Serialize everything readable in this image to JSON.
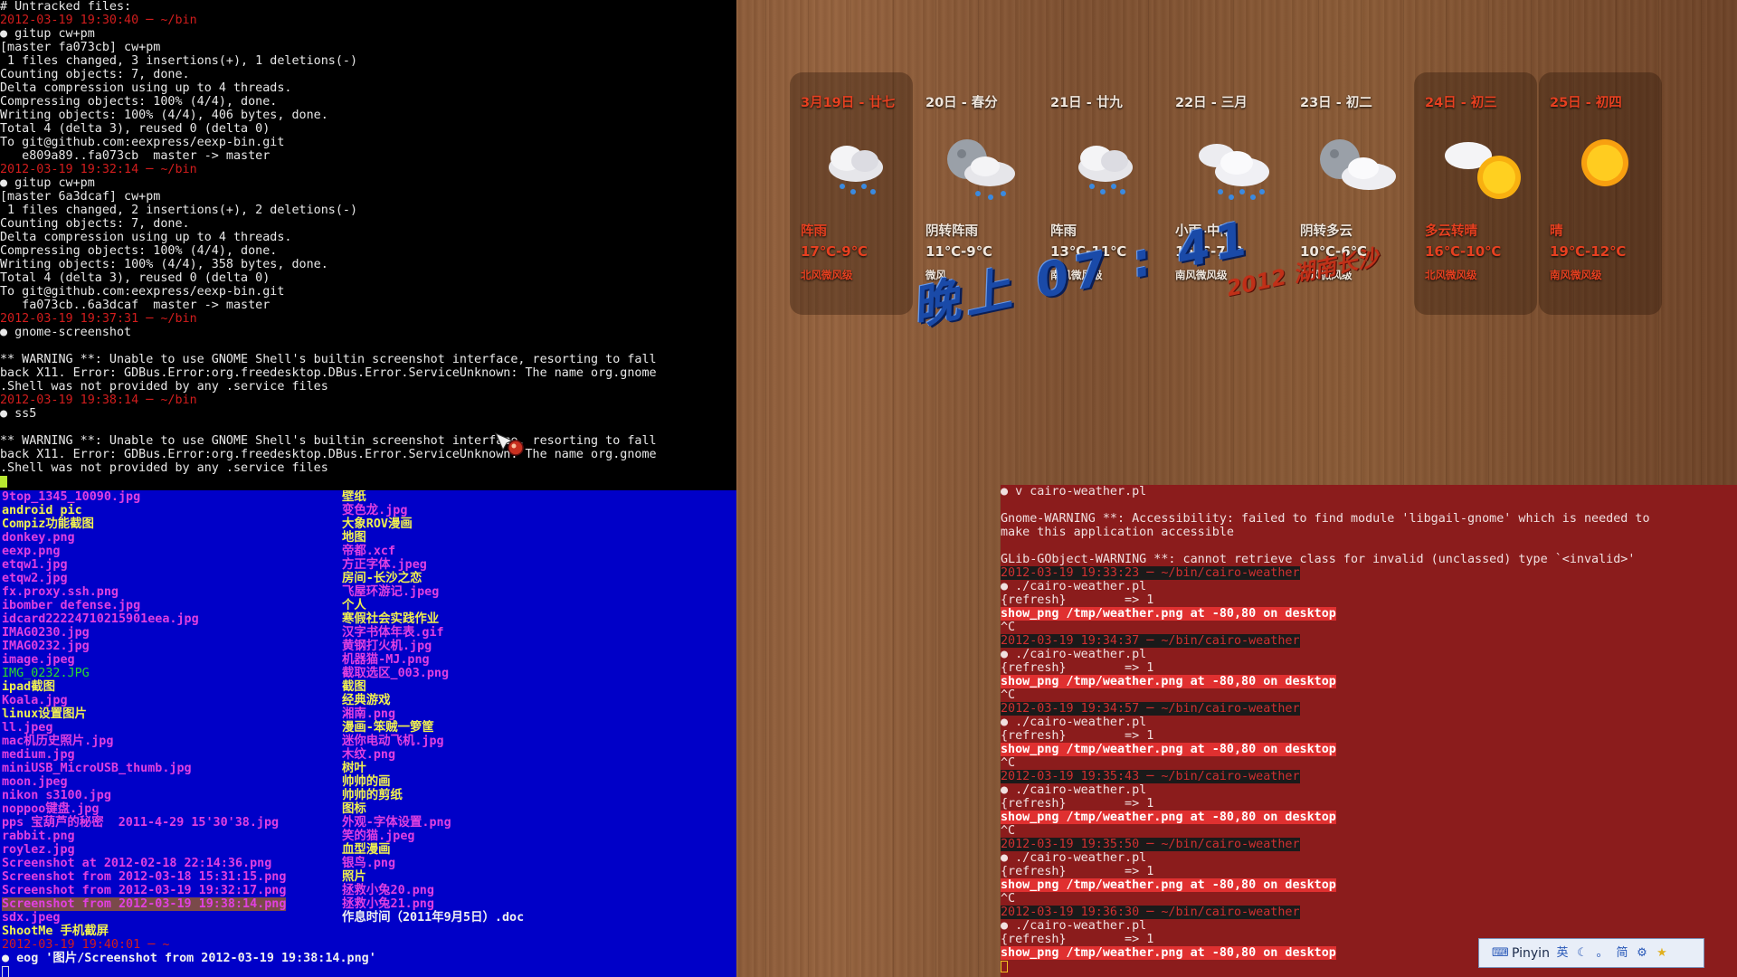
{
  "terminal_git": {
    "lines": [
      {
        "t": "# Untracked files:",
        "c": ""
      },
      {
        "t": "2012-03-19 19:30:40 ─ ~/bin",
        "c": "ts"
      },
      {
        "t": "● gitup cw+pm",
        "c": ""
      },
      {
        "t": "[master fa073cb] cw+pm",
        "c": ""
      },
      {
        "t": " 1 files changed, 3 insertions(+), 1 deletions(-)",
        "c": ""
      },
      {
        "t": "Counting objects: 7, done.",
        "c": ""
      },
      {
        "t": "Delta compression using up to 4 threads.",
        "c": ""
      },
      {
        "t": "Compressing objects: 100% (4/4), done.",
        "c": ""
      },
      {
        "t": "Writing objects: 100% (4/4), 406 bytes, done.",
        "c": ""
      },
      {
        "t": "Total 4 (delta 3), reused 0 (delta 0)",
        "c": ""
      },
      {
        "t": "To git@github.com:eexpress/eexp-bin.git",
        "c": ""
      },
      {
        "t": "   e809a89..fa073cb  master -> master",
        "c": ""
      },
      {
        "t": "2012-03-19 19:32:14 ─ ~/bin",
        "c": "ts"
      },
      {
        "t": "● gitup cw+pm",
        "c": ""
      },
      {
        "t": "[master 6a3dcaf] cw+pm",
        "c": ""
      },
      {
        "t": " 1 files changed, 2 insertions(+), 2 deletions(-)",
        "c": ""
      },
      {
        "t": "Counting objects: 7, done.",
        "c": ""
      },
      {
        "t": "Delta compression using up to 4 threads.",
        "c": ""
      },
      {
        "t": "Compressing objects: 100% (4/4), done.",
        "c": ""
      },
      {
        "t": "Writing objects: 100% (4/4), 358 bytes, done.",
        "c": ""
      },
      {
        "t": "Total 4 (delta 3), reused 0 (delta 0)",
        "c": ""
      },
      {
        "t": "To git@github.com:eexpress/eexp-bin.git",
        "c": ""
      },
      {
        "t": "   fa073cb..6a3dcaf  master -> master",
        "c": ""
      },
      {
        "t": "2012-03-19 19:37:31 ─ ~/bin",
        "c": "ts"
      },
      {
        "t": "● gnome-screenshot",
        "c": ""
      },
      {
        "t": "",
        "c": ""
      },
      {
        "t": "** WARNING **: Unable to use GNOME Shell's builtin screenshot interface, resorting to fall",
        "c": ""
      },
      {
        "t": "back X11. Error: GDBus.Error:org.freedesktop.DBus.Error.ServiceUnknown: The name org.gnome",
        "c": ""
      },
      {
        "t": ".Shell was not provided by any .service files",
        "c": ""
      },
      {
        "t": "2012-03-19 19:38:14 ─ ~/bin",
        "c": "ts"
      },
      {
        "t": "● ss5",
        "c": ""
      },
      {
        "t": "",
        "c": ""
      },
      {
        "t": "** WARNING **: Unable to use GNOME Shell's builtin screenshot interface, resorting to fall",
        "c": ""
      },
      {
        "t": "back X11. Error: GDBus.Error:org.freedesktop.DBus.Error.ServiceUnknown: The name org.gnome",
        "c": ""
      },
      {
        "t": ".Shell was not provided by any .service files",
        "c": ""
      }
    ]
  },
  "terminal_files": {
    "col1": [
      {
        "t": "9top_1345_10090.jpg",
        "c": "mag"
      },
      {
        "t": "android pic",
        "c": "yel"
      },
      {
        "t": "Compiz功能截图",
        "c": "yel"
      },
      {
        "t": "donkey.png",
        "c": "mag"
      },
      {
        "t": "eexp.png",
        "c": "mag"
      },
      {
        "t": "etqw1.jpg",
        "c": "mag"
      },
      {
        "t": "etqw2.jpg",
        "c": "mag"
      },
      {
        "t": "fx.proxy.ssh.png",
        "c": "mag"
      },
      {
        "t": "ibomber defense.jpg",
        "c": "mag"
      },
      {
        "t": "idcard22224710215901eea.jpg",
        "c": "mag"
      },
      {
        "t": "IMAG0230.jpg",
        "c": "mag"
      },
      {
        "t": "IMAG0232.jpg",
        "c": "mag"
      },
      {
        "t": "image.jpeg",
        "c": "mag"
      },
      {
        "t": "IMG_0232.JPG",
        "c": "green"
      },
      {
        "t": "ipad截图",
        "c": "yel"
      },
      {
        "t": "Koala.jpg",
        "c": "mag"
      },
      {
        "t": "linux设置图片",
        "c": "yel"
      },
      {
        "t": "ll.jpeg",
        "c": "mag"
      },
      {
        "t": "mac机历史照片.jpg",
        "c": "mag"
      },
      {
        "t": "medium.jpg",
        "c": "mag"
      },
      {
        "t": "miniUSB_MicroUSB_thumb.jpg",
        "c": "mag"
      },
      {
        "t": "moon.jpeg",
        "c": "mag"
      },
      {
        "t": "nikon s3100.jpg",
        "c": "mag"
      },
      {
        "t": "noppoo键盘.jpg",
        "c": "mag"
      },
      {
        "t": "pps 宝葫芦的秘密  2011-4-29 15'30'38.jpg",
        "c": "mag"
      },
      {
        "t": "rabbit.png",
        "c": "mag"
      },
      {
        "t": "roylez.jpg",
        "c": "mag"
      },
      {
        "t": "Screenshot at 2012-02-18 22:14:36.png",
        "c": "mag"
      },
      {
        "t": "Screenshot from 2012-03-18 15:31:15.png",
        "c": "mag"
      },
      {
        "t": "Screenshot from 2012-03-19 19:32:17.png",
        "c": "mag"
      },
      {
        "t": "Screenshot from 2012-03-19 19:38:14.png",
        "c": "sel"
      },
      {
        "t": "sdx.jpeg",
        "c": "mag"
      },
      {
        "t": "ShootMe 手机截屏",
        "c": "yel"
      },
      {
        "t": "2012-03-19 19:40:01 ─ ~",
        "c": "ts"
      },
      {
        "t": "● eog '图片/Screenshot from 2012-03-19 19:38:14.png'",
        "c": "wht"
      }
    ],
    "col2": [
      {
        "t": "壁纸",
        "c": "yel"
      },
      {
        "t": "变色龙.jpg",
        "c": "mag"
      },
      {
        "t": "大象ROV漫画",
        "c": "yel"
      },
      {
        "t": "地图",
        "c": "yel"
      },
      {
        "t": "帝都.xcf",
        "c": "mag"
      },
      {
        "t": "方正字体.jpeg",
        "c": "mag"
      },
      {
        "t": "房间-长沙之恋",
        "c": "yel"
      },
      {
        "t": "飞屋环游记.jpeg",
        "c": "mag"
      },
      {
        "t": "个人",
        "c": "yel"
      },
      {
        "t": "寒假社会实践作业",
        "c": "yel"
      },
      {
        "t": "汉字书体年表.gif",
        "c": "mag"
      },
      {
        "t": "黄钢打火机.jpg",
        "c": "mag"
      },
      {
        "t": "机器猫-MJ.png",
        "c": "mag"
      },
      {
        "t": "截取选区_003.png",
        "c": "mag"
      },
      {
        "t": "截图",
        "c": "yel"
      },
      {
        "t": "经典游戏",
        "c": "yel"
      },
      {
        "t": "湘南.png",
        "c": "mag"
      },
      {
        "t": "漫画-笨贼一箩筐",
        "c": "yel"
      },
      {
        "t": "迷你电动飞机.jpg",
        "c": "mag"
      },
      {
        "t": "木纹.png",
        "c": "mag"
      },
      {
        "t": "树叶",
        "c": "yel"
      },
      {
        "t": "帅帅的画",
        "c": "yel"
      },
      {
        "t": "帅帅的剪纸",
        "c": "yel"
      },
      {
        "t": "图标",
        "c": "yel"
      },
      {
        "t": "外观-字体设置.png",
        "c": "mag"
      },
      {
        "t": "笑的猫.jpeg",
        "c": "mag"
      },
      {
        "t": "血型漫画",
        "c": "yel"
      },
      {
        "t": "银鸟.png",
        "c": "mag"
      },
      {
        "t": "照片",
        "c": "yel"
      },
      {
        "t": "拯救小兔20.png",
        "c": "mag"
      },
      {
        "t": "拯救小兔21.png",
        "c": "mag"
      },
      {
        "t": "作息时间（2011年9月5日）.doc",
        "c": "wht"
      }
    ]
  },
  "terminal_weather": {
    "lines": [
      {
        "t": "● v cairo-weather.pl",
        "c": ""
      },
      {
        "t": "",
        "c": ""
      },
      {
        "t": "Gnome-WARNING **: Accessibility: failed to find module 'libgail-gnome' which is needed to",
        "c": ""
      },
      {
        "t": "make this application accessible",
        "c": ""
      },
      {
        "t": "",
        "c": ""
      },
      {
        "t": "GLib-GObject-WARNING **: cannot retrieve class for invalid (unclassed) type `<invalid>'",
        "c": ""
      },
      {
        "t": "2012-03-19 19:33:23 ─ ~/bin/cairo-weather",
        "c": "tsbar"
      },
      {
        "t": "● ./cairo-weather.pl",
        "c": ""
      },
      {
        "t": "{refresh}        => 1",
        "c": ""
      },
      {
        "t": "show_png /tmp/weather.png at -80,80 on desktop",
        "c": "hl"
      },
      {
        "t": "^C",
        "c": ""
      },
      {
        "t": "2012-03-19 19:34:37 ─ ~/bin/cairo-weather",
        "c": "tsbar"
      },
      {
        "t": "● ./cairo-weather.pl",
        "c": ""
      },
      {
        "t": "{refresh}        => 1",
        "c": ""
      },
      {
        "t": "show_png /tmp/weather.png at -80,80 on desktop",
        "c": "hl"
      },
      {
        "t": "^C",
        "c": ""
      },
      {
        "t": "2012-03-19 19:34:57 ─ ~/bin/cairo-weather",
        "c": "tsbar"
      },
      {
        "t": "● ./cairo-weather.pl",
        "c": ""
      },
      {
        "t": "{refresh}        => 1",
        "c": ""
      },
      {
        "t": "show_png /tmp/weather.png at -80,80 on desktop",
        "c": "hl"
      },
      {
        "t": "^C",
        "c": ""
      },
      {
        "t": "2012-03-19 19:35:43 ─ ~/bin/cairo-weather",
        "c": "tsbar"
      },
      {
        "t": "● ./cairo-weather.pl",
        "c": ""
      },
      {
        "t": "{refresh}        => 1",
        "c": ""
      },
      {
        "t": "show_png /tmp/weather.png at -80,80 on desktop",
        "c": "hl"
      },
      {
        "t": "^C",
        "c": ""
      },
      {
        "t": "2012-03-19 19:35:50 ─ ~/bin/cairo-weather",
        "c": "tsbar"
      },
      {
        "t": "● ./cairo-weather.pl",
        "c": ""
      },
      {
        "t": "{refresh}        => 1",
        "c": ""
      },
      {
        "t": "show_png /tmp/weather.png at -80,80 on desktop",
        "c": "hl"
      },
      {
        "t": "^C",
        "c": ""
      },
      {
        "t": "2012-03-19 19:36:30 ─ ~/bin/cairo-weather",
        "c": "tsbar"
      },
      {
        "t": "● ./cairo-weather.pl",
        "c": ""
      },
      {
        "t": "{refresh}        => 1",
        "c": ""
      },
      {
        "t": "show_png /tmp/weather.png at -80,80 on desktop",
        "c": "hl"
      }
    ]
  },
  "weather": {
    "days": [
      {
        "date": "3月19日 - 廿七",
        "cond": "阵雨",
        "temp": "17℃-9℃",
        "wind": "北风微风级",
        "icon": "rain-cloud-icon",
        "highlight": true,
        "accent": true
      },
      {
        "date": "20日 - 春分",
        "cond": "阴转阵雨",
        "temp": "11℃-9℃",
        "wind": "微风",
        "icon": "night-rain-cloud-icon",
        "highlight": false,
        "accent": false
      },
      {
        "date": "21日 - 廿九",
        "cond": "阵雨",
        "temp": "13℃-11℃",
        "wind": "南风微风级",
        "icon": "rain-cloud-icon",
        "highlight": false,
        "accent": false
      },
      {
        "date": "22日 - 三月",
        "cond": "小雨-中雨",
        "temp": "15℃-7℃",
        "wind": "南风微风级",
        "icon": "heavy-rain-cloud-icon",
        "highlight": false,
        "accent": false
      },
      {
        "date": "23日 - 初二",
        "cond": "阴转多云",
        "temp": "10℃-6℃",
        "wind": "北风微风级",
        "icon": "night-cloud-icon",
        "highlight": false,
        "accent": false
      },
      {
        "date": "24日 - 初三",
        "cond": "多云转晴",
        "temp": "16℃-10℃",
        "wind": "北风微风级",
        "icon": "sun-cloud-icon",
        "highlight": true,
        "accent": true
      },
      {
        "date": "25日 - 初四",
        "cond": "晴",
        "temp": "19℃-12℃",
        "wind": "南风微风级",
        "icon": "sun-icon",
        "highlight": true,
        "accent": true
      }
    ],
    "clock": "晚上 07 : 41",
    "city": "2012 湖南长沙"
  },
  "panel": {
    "label": "Pinyin",
    "icons": [
      "keyboard-icon",
      "english-icon",
      "moon-icon",
      "punctuation-icon",
      "simplified-icon",
      "gear-icon",
      "star-icon"
    ]
  },
  "colors": {
    "terminal_black": "#000000",
    "terminal_blue": "#0000c8",
    "terminal_red": "#8b1c1c",
    "accent_red": "#e64020"
  }
}
